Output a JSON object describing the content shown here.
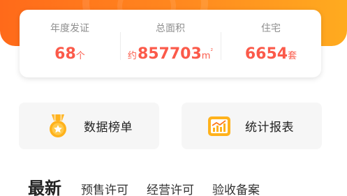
{
  "stats": [
    {
      "label": "年度发证",
      "prefix": "",
      "value": "68",
      "unit": "个",
      "unit_sup": ""
    },
    {
      "label": "总面积",
      "prefix": "约",
      "value": "857703",
      "unit": "m",
      "unit_sup": "²"
    },
    {
      "label": "住宅",
      "prefix": "",
      "value": "6654",
      "unit": "套",
      "unit_sup": ""
    }
  ],
  "quick_links": [
    {
      "label": "数据榜单",
      "icon": "ranking-medal-icon"
    },
    {
      "label": "统计报表",
      "icon": "statistics-chart-icon"
    }
  ],
  "tabs": [
    {
      "label": "最新",
      "active": true
    },
    {
      "label": "预售许可",
      "active": false
    },
    {
      "label": "经营许可",
      "active": false
    },
    {
      "label": "验收备案",
      "active": false
    }
  ],
  "colors": {
    "accent": "#fb5a4a",
    "banner": "#ff7a1c",
    "icon_gold": "#ffb21c"
  }
}
